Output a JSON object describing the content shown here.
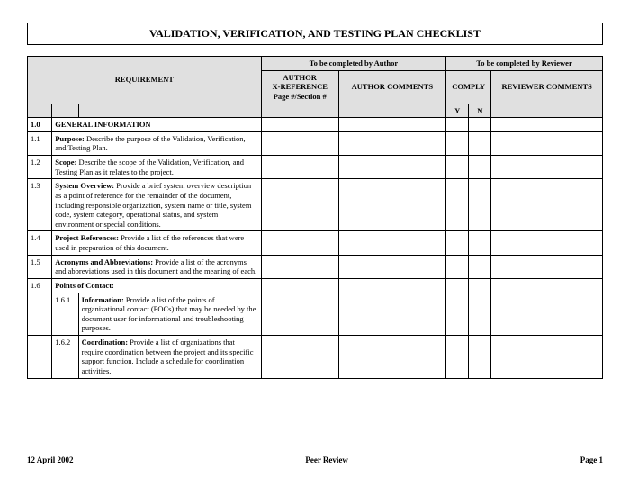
{
  "title": "VALIDATION, VERIFICATION, AND TESTING PLAN CHECKLIST",
  "headers": {
    "author_section": "To be completed by Author",
    "reviewer_section": "To be completed by Reviewer",
    "requirement": "REQUIREMENT",
    "xref_line1": "AUTHOR",
    "xref_line2": "X-REFERENCE",
    "xref_line3": "Page #/Section #",
    "author_comments": "AUTHOR COMMENTS",
    "comply": "COMPLY",
    "reviewer_comments": "REVIEWER COMMENTS",
    "y": "Y",
    "n": "N"
  },
  "section": {
    "num": "1.0",
    "title": "GENERAL INFORMATION"
  },
  "rows": [
    {
      "num": "1.1",
      "bold": "Purpose:",
      "text": "  Describe the purpose of the Validation, Verification, and Testing Plan."
    },
    {
      "num": "1.2",
      "bold": "Scope:",
      "text": "  Describe the scope of the Validation, Verification, and Testing Plan as it relates to the project."
    },
    {
      "num": "1.3",
      "bold": "System Overview:",
      "text": "  Provide a brief system overview description as a point of reference for the remainder of the document, including responsible organization, system name or title, system code, system category, operational status, and system environment or special conditions."
    },
    {
      "num": "1.4",
      "bold": "Project References:",
      "text": "  Provide a list of the references that were used in preparation of this document."
    },
    {
      "num": "1.5",
      "bold": "Acronyms and Abbreviations:",
      "text": "  Provide a list of the acronyms and abbreviations used in this document and the meaning of each."
    },
    {
      "num": "1.6",
      "bold": "Points of Contact:",
      "text": ""
    }
  ],
  "subrows": [
    {
      "num": "1.6.1",
      "bold": "Information:",
      "text": "  Provide a list of the points of organizational contact (POCs) that may be needed by the document user for informational and troubleshooting purposes."
    },
    {
      "num": "1.6.2",
      "bold": "Coordination:",
      "text": "  Provide a list of organizations that require coordination between the project and its specific support function.  Include a schedule for coordination activities."
    }
  ],
  "footer": {
    "date": "12 April 2002",
    "center": "Peer Review",
    "page": "Page 1"
  }
}
